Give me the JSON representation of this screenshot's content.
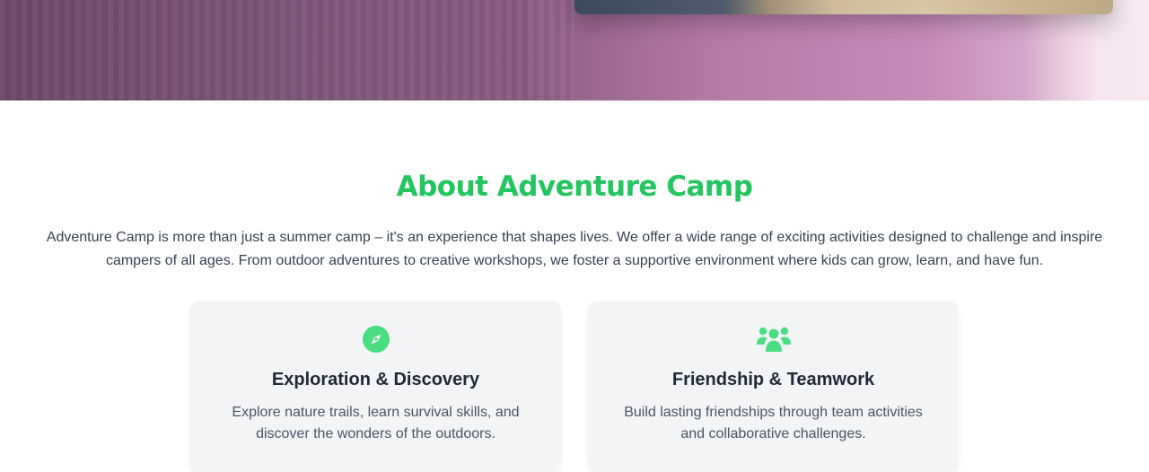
{
  "about": {
    "title": "About Adventure Camp",
    "description": "Adventure Camp is more than just a summer camp – it's an experience that shapes lives. We offer a wide range of exciting activities designed to challenge and inspire campers of all ages. From outdoor adventures to creative workshops, we foster a supportive environment where kids can grow, learn, and have fun."
  },
  "features": [
    {
      "icon": "compass-icon",
      "title": "Exploration & Discovery",
      "text": "Explore nature trails, learn survival skills, and discover the wonders of the outdoors."
    },
    {
      "icon": "users-group-icon",
      "title": "Friendship & Teamwork",
      "text": "Build lasting friendships through team activities and collaborative challenges."
    }
  ],
  "colors": {
    "accent": "#22c55e",
    "icon": "#4ade80",
    "card_bg": "#f3f4f6"
  }
}
